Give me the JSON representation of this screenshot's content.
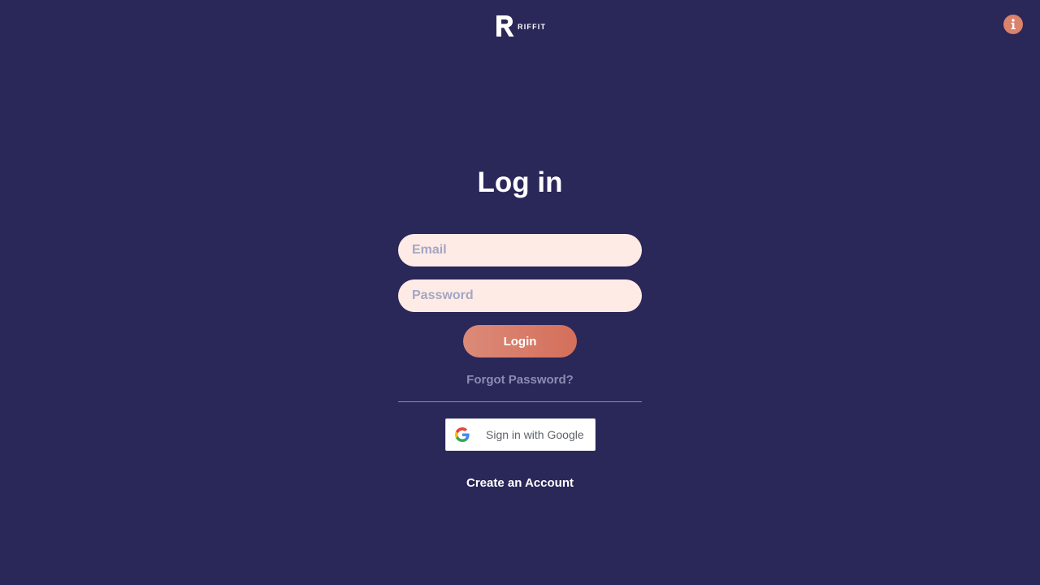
{
  "header": {
    "brand": "RIFFIT",
    "logo_icon": "riffit-r-logo-icon",
    "info_icon": "info-icon",
    "info_color": "#d9826c"
  },
  "login": {
    "title": "Log in",
    "email_placeholder": "Email",
    "email_value": "",
    "password_placeholder": "Password",
    "password_value": "",
    "login_label": "Login",
    "forgot_label": "Forgot Password?",
    "google_label": "Sign in with Google",
    "google_icon": "google-g-icon",
    "create_label": "Create an Account"
  },
  "colors": {
    "background": "#2a2759",
    "input_background": "#feebe6",
    "accent": "#d9826c",
    "muted_text": "#8a8db3"
  }
}
